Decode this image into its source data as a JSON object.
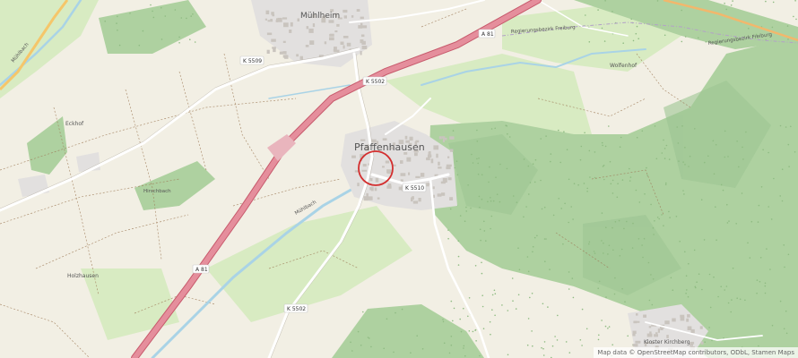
{
  "places": {
    "main_town": "Pfaffenhausen",
    "north_town": "Mühlheim",
    "west_hamlet": "Eckhof",
    "southwest_hamlet": "Holzhausen",
    "southeast_place": "Kloster Kirchberg",
    "east_farm": "Wolfenhof"
  },
  "boundaries": {
    "north": "Regierungsbezirk Freiburg",
    "east": "Regierungsbezirk Freiburg"
  },
  "streams": {
    "main": "Mühlbach",
    "north": "Mühlbach",
    "small": "Hirschbach"
  },
  "roads": {
    "motorway_north": "A 81",
    "motorway_south": "A 81",
    "k5509": "K 5509",
    "k5502_north": "K 5502",
    "k5502_south": "K 5502",
    "k5510": "K 5510"
  },
  "attribution": "Map data © OpenStreetMap contributors, ODbL, Stamen Maps",
  "colors": {
    "farmland": "#f2efe4",
    "meadow": "#d8ebc2",
    "forest": "#aed1a0",
    "forest_dark": "#9dc493",
    "residential": "#e2e0df",
    "building": "#c9c4be",
    "motorway": "#e58e9c",
    "motorway_casing": "#c75a6c",
    "water": "#a9d3e6",
    "road": "#ffffff",
    "track": "#9e7b58",
    "highlight_circle": "#d32f2f"
  }
}
